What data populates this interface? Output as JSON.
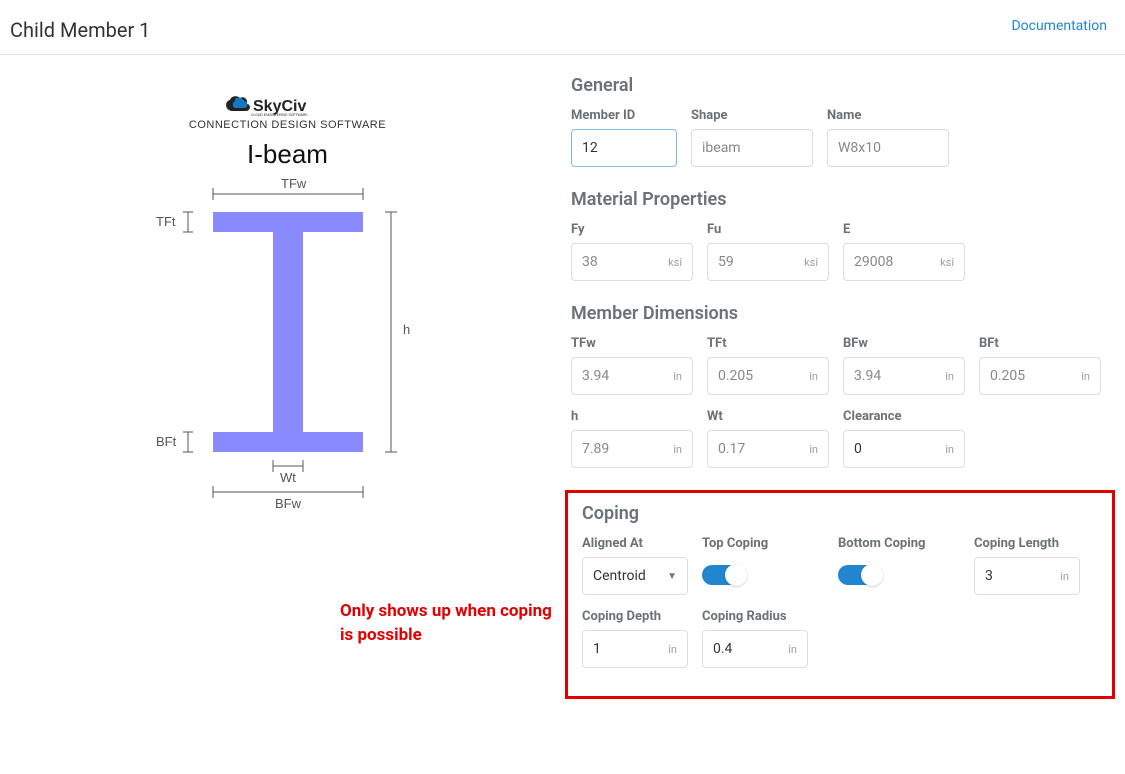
{
  "header": {
    "title": "Child Member 1",
    "doc_link": "Documentation"
  },
  "brand": {
    "name": "SkyCiv",
    "sub": "CONNECTION DESIGN SOFTWARE"
  },
  "diagram": {
    "title": "I-beam",
    "labels": {
      "TFw": "TFw",
      "TFt": "TFt",
      "BFt": "BFt",
      "BFw": "BFw",
      "Wt": "Wt",
      "h": "h"
    }
  },
  "general": {
    "title": "General",
    "member_id": {
      "label": "Member ID",
      "value": "12"
    },
    "shape": {
      "label": "Shape",
      "value": "ibeam"
    },
    "name": {
      "label": "Name",
      "value": "W8x10"
    }
  },
  "material": {
    "title": "Material Properties",
    "Fy": {
      "label": "Fy",
      "value": "38",
      "unit": "ksi"
    },
    "Fu": {
      "label": "Fu",
      "value": "59",
      "unit": "ksi"
    },
    "E": {
      "label": "E",
      "value": "29008",
      "unit": "ksi"
    }
  },
  "dimensions": {
    "title": "Member Dimensions",
    "TFw": {
      "label": "TFw",
      "value": "3.94",
      "unit": "in"
    },
    "TFt": {
      "label": "TFt",
      "value": "0.205",
      "unit": "in"
    },
    "BFw": {
      "label": "BFw",
      "value": "3.94",
      "unit": "in"
    },
    "BFt": {
      "label": "BFt",
      "value": "0.205",
      "unit": "in"
    },
    "h": {
      "label": "h",
      "value": "7.89",
      "unit": "in"
    },
    "Wt": {
      "label": "Wt",
      "value": "0.17",
      "unit": "in"
    },
    "Clearance": {
      "label": "Clearance",
      "value": "0",
      "unit": "in"
    }
  },
  "coping": {
    "title": "Coping",
    "aligned_at": {
      "label": "Aligned At",
      "value": "Centroid"
    },
    "top_coping": {
      "label": "Top Coping",
      "on": true
    },
    "bottom_coping": {
      "label": "Bottom Coping",
      "on": true
    },
    "coping_length": {
      "label": "Coping Length",
      "value": "3",
      "unit": "in"
    },
    "coping_depth": {
      "label": "Coping Depth",
      "value": "1",
      "unit": "in"
    },
    "coping_radius": {
      "label": "Coping Radius",
      "value": "0.4",
      "unit": "in"
    }
  },
  "annotation": "Only shows up when coping is possible"
}
